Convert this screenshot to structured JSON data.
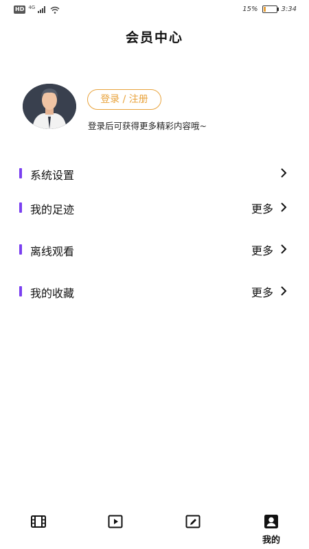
{
  "status": {
    "hd": "HD",
    "network": "4G",
    "battery_pct": "15%",
    "battery_level": 0.15,
    "time": "3:34"
  },
  "header": {
    "title": "会员中心"
  },
  "profile": {
    "login_button": "登录 / 注册",
    "hint": "登录后可获得更多精彩内容哦~"
  },
  "menu": [
    {
      "label": "系统设置",
      "more": ""
    },
    {
      "label": "我的足迹",
      "more": "更多"
    },
    {
      "label": "离线观看",
      "more": "更多"
    },
    {
      "label": "我的收藏",
      "more": "更多"
    }
  ],
  "tabbar": {
    "tabs": [
      {
        "icon": "film-icon",
        "label": ""
      },
      {
        "icon": "play-icon",
        "label": ""
      },
      {
        "icon": "edit-icon",
        "label": ""
      },
      {
        "icon": "profile-icon",
        "label": "我的"
      }
    ]
  },
  "colors": {
    "accent": "#e8a23a",
    "menu_bar": "#7a3ff0"
  }
}
